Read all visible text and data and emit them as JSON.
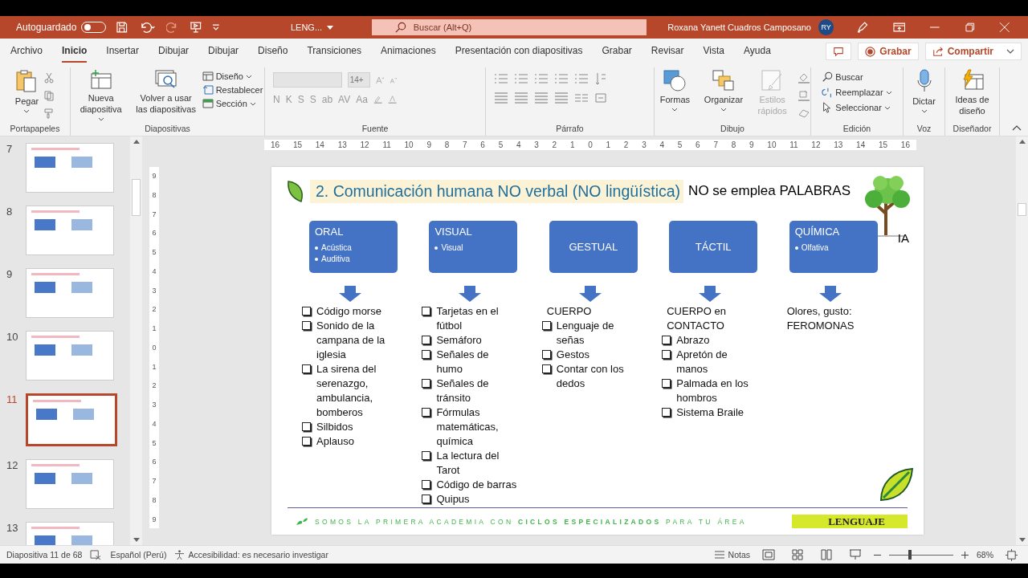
{
  "title_bar": {
    "autosave_label": "Autoguardado",
    "autosave_on": false,
    "file_name": "LENG...",
    "search_placeholder": "Buscar (Alt+Q)",
    "user_name": "Roxana Yanett Cuadros Camposano",
    "user_initials": "RY"
  },
  "menu_tabs": [
    {
      "label": "Archivo",
      "selected": false
    },
    {
      "label": "Inicio",
      "selected": true
    },
    {
      "label": "Insertar",
      "selected": false
    },
    {
      "label": "Dibujar",
      "selected": false
    },
    {
      "label": "Dibujar",
      "selected": false
    },
    {
      "label": "Diseño",
      "selected": false
    },
    {
      "label": "Transiciones",
      "selected": false
    },
    {
      "label": "Animaciones",
      "selected": false
    },
    {
      "label": "Presentación con diapositivas",
      "selected": false
    },
    {
      "label": "Grabar",
      "selected": false
    },
    {
      "label": "Revisar",
      "selected": false
    },
    {
      "label": "Vista",
      "selected": false
    },
    {
      "label": "Ayuda",
      "selected": false
    }
  ],
  "record_button": "Grabar",
  "share_button": "Compartir",
  "ribbon": {
    "clipboard": {
      "label": "Portapapeles",
      "paste": "Pegar"
    },
    "slides": {
      "label": "Diapositivas",
      "new_slide": "Nueva diapositiva",
      "reuse": "Volver a usar las diapositivas",
      "layout": "Diseño",
      "reset": "Restablecer",
      "section": "Sección"
    },
    "font": {
      "label": "Fuente",
      "size": "14+",
      "format_buttons": [
        "N",
        "K",
        "S",
        "S",
        "ab",
        "AV",
        "Aa"
      ]
    },
    "paragraph": {
      "label": "Párrafo"
    },
    "drawing": {
      "label": "Dibujo",
      "shapes": "Formas",
      "arrange": "Organizar",
      "quick_styles": "Estilos rápidos",
      "quick_styles_disabled": true
    },
    "editing": {
      "label": "Edición",
      "find": "Buscar",
      "replace": "Reemplazar",
      "select": "Seleccionar"
    },
    "voice": {
      "label": "Voz",
      "dictate": "Dictar"
    },
    "designer": {
      "label": "Diseñador",
      "ideas": "Ideas de diseño"
    }
  },
  "thumbnails": [
    {
      "number": "7",
      "selected": false
    },
    {
      "number": "8",
      "selected": false
    },
    {
      "number": "9",
      "selected": false
    },
    {
      "number": "10",
      "selected": false
    },
    {
      "number": "11",
      "selected": true
    },
    {
      "number": "12",
      "selected": false
    },
    {
      "number": "13",
      "selected": false
    }
  ],
  "horizontal_ruler": [
    "16",
    "15",
    "14",
    "13",
    "12",
    "11",
    "10",
    "9",
    "8",
    "7",
    "6",
    "5",
    "4",
    "3",
    "2",
    "1",
    "0",
    "1",
    "2",
    "3",
    "4",
    "5",
    "6",
    "7",
    "8",
    "9",
    "10",
    "11",
    "12",
    "13",
    "14",
    "15",
    "16"
  ],
  "vertical_ruler": [
    "9",
    "8",
    "7",
    "6",
    "5",
    "4",
    "3",
    "2",
    "1",
    "0",
    "1",
    "2",
    "3",
    "4",
    "5",
    "6",
    "7",
    "8",
    "9"
  ],
  "slide": {
    "title": "2. Comunicación humana NO verbal (NO lingüística)",
    "subtitle": "NO se emplea PALABRAS",
    "logo_text": "IA",
    "categories": [
      {
        "name": "ORAL",
        "bullets": [
          "Acústica",
          "Auditiva"
        ],
        "items": [
          "Código morse",
          "Sonido de la campana de la iglesia",
          "La sirena del serenazgo, ambulancia, bomberos",
          "Silbidos",
          "Aplauso"
        ]
      },
      {
        "name": "VISUAL",
        "bullets": [
          "Visual"
        ],
        "items": [
          "Tarjetas en el fútbol",
          "Semáforo",
          "Señales de humo",
          "Señales de tránsito",
          "Fórmulas matemáticas, química",
          "La lectura del Tarot",
          "Código de barras",
          "Quipus"
        ]
      },
      {
        "name": "GESTUAL",
        "intro": [
          "CUERPO"
        ],
        "items": [
          "Lenguaje de señas",
          "Gestos",
          "Contar con los dedos"
        ]
      },
      {
        "name": "TÁCTIL",
        "intro": [
          "CUERPO en CONTACTO"
        ],
        "items": [
          "Abrazo",
          "Apretón de manos",
          "Palmada en los hombros",
          "Sistema Braile"
        ]
      },
      {
        "name": "QUÍMICA",
        "bullets": [
          "Olfativa"
        ],
        "intro": [
          "Olores, gusto: FEROMONAS"
        ]
      }
    ],
    "footer": "SOMOS LA PRIMERA ACADEMIA CON **CICLOS ESPECIALIZADOS** PARA TU ÁREA",
    "footer_badge": "LENGUAJE"
  },
  "status_bar": {
    "slide_count": "Diapositiva 11 de 68",
    "language": "Español (Perú)",
    "accessibility": "Accesibilidad: es necesario investigar",
    "notes": "Notas",
    "zoom_slider": {
      "level": 0.3
    },
    "zoom": "68%"
  }
}
